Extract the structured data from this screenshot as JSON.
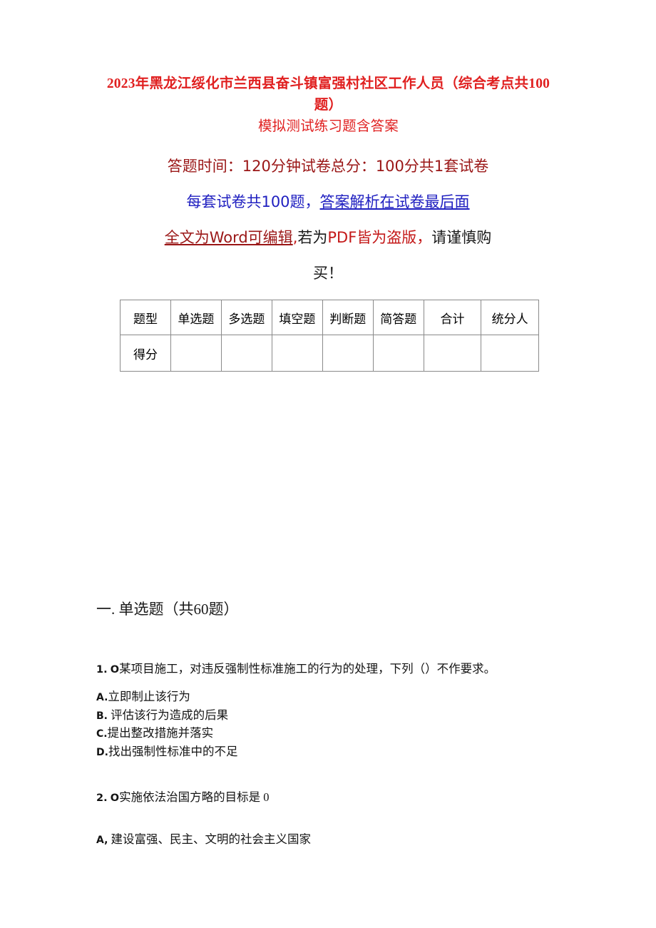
{
  "document": {
    "title_line1": "2023年黑龙江绥化市兰西县奋斗镇富强村社区工作人员（综合考点共100题）",
    "title_line2": "模拟测试练习题含答案",
    "title_color": "#e02020"
  },
  "subtitle": {
    "line1": "答题时间：120分钟试卷总分：100分共1套试卷",
    "line1_color": "#9a1616",
    "line2_part1": "每套试卷共100题，",
    "line2_part2_underlined": "答案解析在试卷最后面",
    "line2_color": "#1f1fc0",
    "line3_part1_underlined": "全文为Word可编辑",
    "line3_part2": ",",
    "line3_part3": "若为",
    "line3_part4": "PDF皆为盗版，",
    "line3_part5": "请谨慎购",
    "line4": "买！",
    "line3_red": "#c41818",
    "line3_darkred": "#9a1616",
    "line3_black": "#1a1a1a"
  },
  "score_table": {
    "headers": [
      "题型",
      "单选题",
      "多选题",
      "填空题",
      "判断题",
      "简答题",
      "合计",
      "统分人"
    ],
    "score_row_label": "得分",
    "score_row_values": [
      "",
      "",
      "",
      "",
      "",
      "",
      ""
    ]
  },
  "section": {
    "heading": "一. 单选题（共60题）"
  },
  "questions": [
    {
      "number": "1.",
      "marker": "O",
      "stem": "某项目施工，对违反强制性标准施工的行为的处理，下列（）不作要求。",
      "options": [
        {
          "key": "A.",
          "text": "立即制止该行为"
        },
        {
          "key": "B.",
          "text": " 评估该行为造成的后果"
        },
        {
          "key": "C.",
          "text": "提出整改措施并落实"
        },
        {
          "key": "D.",
          "text": "找出强制性标准中的不足"
        }
      ]
    },
    {
      "number": "2.",
      "marker": "O",
      "stem": "实施依法治国方略的目标是 0",
      "options": [
        {
          "key": "A,",
          "text": " 建设富强、民主、文明的社会主义国家"
        }
      ]
    }
  ]
}
